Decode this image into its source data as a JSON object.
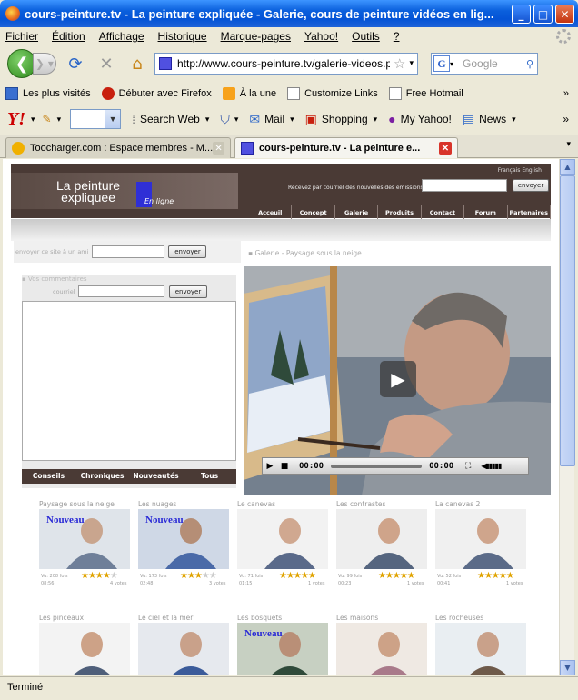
{
  "window": {
    "title": "cours-peinture.tv - La peinture expliquée - Galerie, cours de peinture vidéos en lig..."
  },
  "menu": [
    "Fichier",
    "Édition",
    "Affichage",
    "Historique",
    "Marque-pages",
    "Yahoo!",
    "Outils",
    "?"
  ],
  "nav": {
    "url": "http://www.cours-peinture.tv/galerie-videos.p",
    "search_placeholder": "Google"
  },
  "bookmarks": [
    "Les plus visités",
    "Débuter avec Firefox",
    "À la une",
    "Customize Links",
    "Free Hotmail"
  ],
  "yahoo": {
    "search_web": "Search Web",
    "mail": "Mail",
    "shopping": "Shopping",
    "myyahoo": "My Yahoo!",
    "news": "News"
  },
  "tabs": [
    {
      "label": "Toocharger.com : Espace membres - M..."
    },
    {
      "label": "cours-peinture.tv - La peinture e..."
    }
  ],
  "status": "Terminé",
  "site": {
    "logo_line1": "La peinture",
    "logo_line2": "expliquee",
    "logo_sub": "En ligne",
    "langs": "Français  English",
    "newsletter_text": "Recevez par courriel des nouvelles des émissions",
    "envoyer": "envoyer",
    "nav": [
      "Acceuil",
      "Concept",
      "Galerie",
      "Produits",
      "Contact",
      "Forum",
      "Partenaires"
    ],
    "share_label": "envoyer ce site à un ami",
    "comments_title": "Vos commentaires",
    "courriel": "courriel",
    "comment_tabs": [
      "Conseils",
      "Chroniques",
      "Nouveautés",
      "Tous"
    ],
    "gallery_title": "Galerie - Paysage sous la neige",
    "video": {
      "time_current": "00:00",
      "time_total": "00:00"
    },
    "nouveau": "Nouveau"
  },
  "thumbs": [
    {
      "title": "Paysage sous la neige",
      "views": "Vu: 208 fois",
      "duration": "08:56",
      "stars": 4,
      "votes": "4 votes",
      "nouveau": true
    },
    {
      "title": "Les nuages",
      "views": "Vu: 173 fois",
      "duration": "02:48",
      "stars": 3,
      "votes": "3 votes",
      "nouveau": true
    },
    {
      "title": "Le canevas",
      "views": "Vu: 71 fois",
      "duration": "01:15",
      "stars": 5,
      "votes": "1 votes",
      "nouveau": false
    },
    {
      "title": "Les contrastes",
      "views": "Vu: 99 fois",
      "duration": "00:23",
      "stars": 5,
      "votes": "1 votes",
      "nouveau": false
    },
    {
      "title": "La canevas 2",
      "views": "Vu: 52 fois",
      "duration": "00:41",
      "stars": 5,
      "votes": "1 votes",
      "nouveau": false
    },
    {
      "title": "Les pinceaux",
      "nouveau": false
    },
    {
      "title": "Le ciel et la mer",
      "nouveau": false
    },
    {
      "title": "Les bosquets",
      "nouveau": true
    },
    {
      "title": "Les maisons",
      "nouveau": false
    },
    {
      "title": "Les rocheuses",
      "nouveau": false
    }
  ]
}
